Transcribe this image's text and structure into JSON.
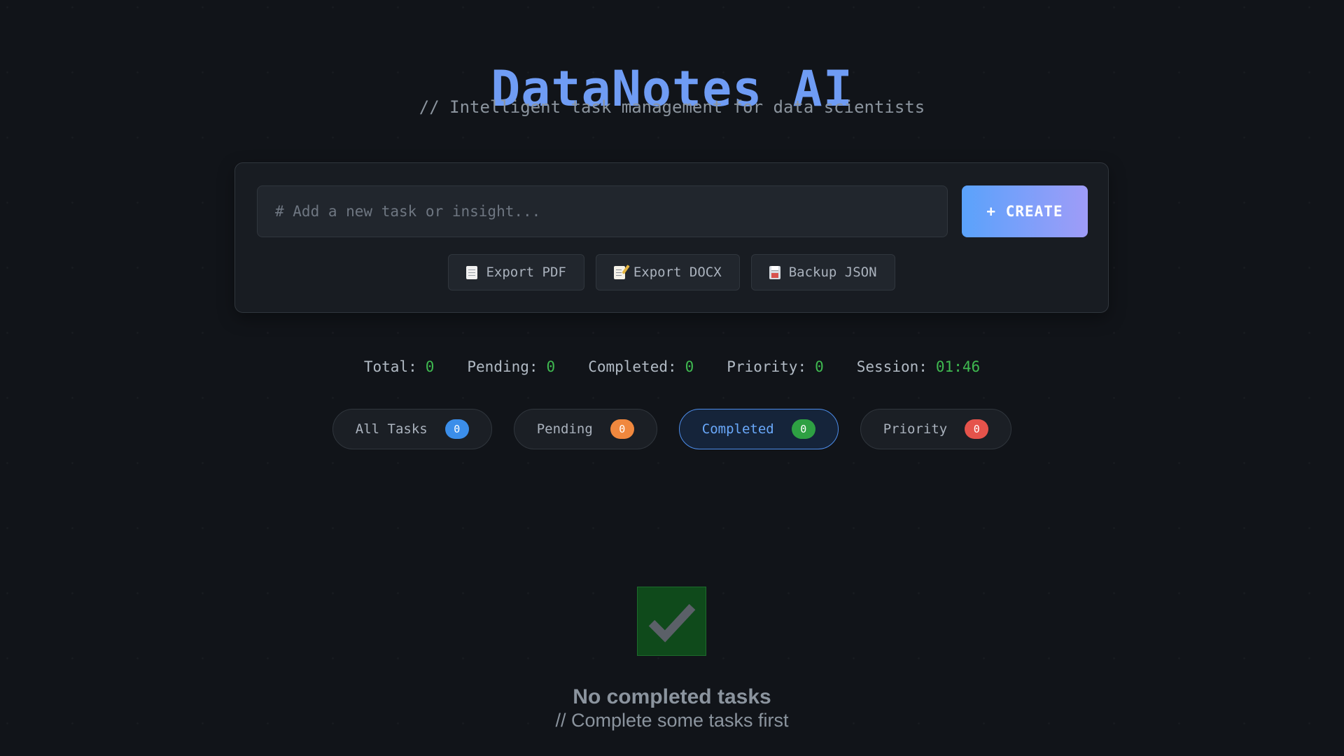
{
  "header": {
    "title": "DataNotes AI",
    "subtitle": "// Intelligent task management for data scientists"
  },
  "composer": {
    "input_placeholder": "# Add a new task or insight...",
    "input_value": "",
    "create_label": "+ CREATE",
    "create_gradient": [
      "#5aa2fb",
      "#9f9cf8"
    ],
    "exports": [
      {
        "label": "Export PDF",
        "icon": "page-facing-up-icon"
      },
      {
        "label": "Export DOCX",
        "icon": "memo-icon"
      },
      {
        "label": "Backup JSON",
        "icon": "floppy-disk-icon"
      }
    ]
  },
  "stats": [
    {
      "label": "Total:",
      "value": "0"
    },
    {
      "label": "Pending:",
      "value": "0"
    },
    {
      "label": "Completed:",
      "value": "0"
    },
    {
      "label": "Priority:",
      "value": "0"
    },
    {
      "label": "Session:",
      "value": "01:46"
    }
  ],
  "filters": [
    {
      "label": "All Tasks",
      "count": "0",
      "color": "#3b8eea",
      "active": false
    },
    {
      "label": "Pending",
      "count": "0",
      "color": "#f0883e",
      "active": false
    },
    {
      "label": "Completed",
      "count": "0",
      "color": "#2ea043",
      "active": true
    },
    {
      "label": "Priority",
      "count": "0",
      "color": "#e5534b",
      "active": false
    }
  ],
  "empty_state": {
    "icon": "check-mark-icon",
    "title": "No completed tasks",
    "subtitle": "// Complete some tasks first"
  },
  "colors": {
    "accent": "#6f9cf4",
    "stat_value": "#3fb950",
    "background": "#111419"
  }
}
